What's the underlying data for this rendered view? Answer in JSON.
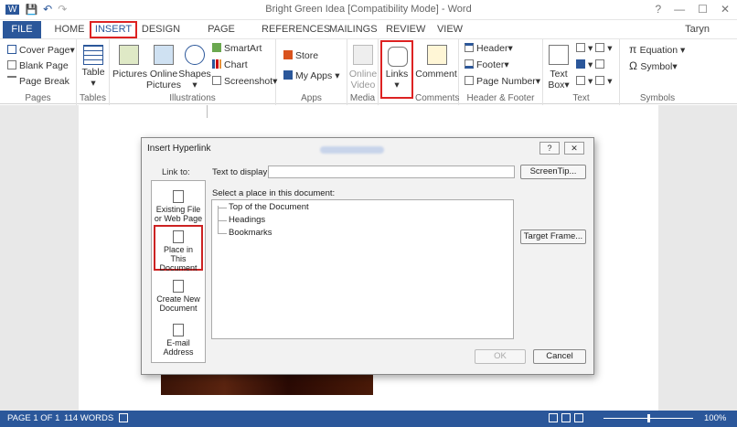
{
  "window": {
    "title": "Bright Green Idea [Compatibility Mode] - Word",
    "user": "Taryn",
    "controls": [
      "?",
      "—",
      "☐",
      "✕"
    ]
  },
  "qat": [
    "W",
    "💾",
    "↶",
    "↷"
  ],
  "tabs": [
    "FILE",
    "HOME",
    "INSERT",
    "DESIGN",
    "PAGE LAYOUT",
    "REFERENCES",
    "MAILINGS",
    "REVIEW",
    "VIEW"
  ],
  "ribbon": {
    "pages": {
      "items": [
        "Cover Page",
        "Blank Page",
        "Page Break"
      ],
      "label": "Pages"
    },
    "tables": {
      "item": "Table",
      "label": "Tables"
    },
    "illustrations": {
      "pictures": "Pictures",
      "online1": "Online",
      "online2": "Pictures",
      "shapes": "Shapes",
      "smartart": "SmartArt",
      "chart": "Chart",
      "screenshot": "Screenshot",
      "label": "Illustrations"
    },
    "apps": {
      "store": "Store",
      "myapps": "My Apps",
      "label": "Apps"
    },
    "media": {
      "v1": "Online",
      "v2": "Video",
      "label": "Media"
    },
    "links": {
      "item": "Links"
    },
    "comments": {
      "item": "Comment",
      "label": "Comments"
    },
    "header_footer": {
      "header": "Header",
      "footer": "Footer",
      "pagenumber": "Page Number",
      "label": "Header & Footer"
    },
    "text": {
      "t1": "Text",
      "t2": "Box",
      "label": "Text"
    },
    "symbols": {
      "equation": "Equation",
      "symbol": "Symbol",
      "label": "Symbols"
    }
  },
  "dialog": {
    "title": "Insert Hyperlink",
    "help": "?",
    "close": "✕",
    "link_to": "Link to:",
    "text_to_display": "Text to display:",
    "screentip": "ScreenTip...",
    "select_place": "Select a place in this document:",
    "target_frame": "Target Frame...",
    "tree": [
      "Top of the Document",
      "Headings",
      "Bookmarks"
    ],
    "link_types": [
      {
        "l1": "Existing File",
        "l2": "or Web Page"
      },
      {
        "l1": "Place in This",
        "l2": "Document"
      },
      {
        "l1": "Create New",
        "l2": "Document"
      },
      {
        "l1": "E-mail",
        "l2": "Address"
      }
    ],
    "ok": "OK",
    "cancel": "Cancel"
  },
  "status": {
    "page": "PAGE 1 OF 1",
    "words": "114 WORDS",
    "zoom": "100%"
  }
}
